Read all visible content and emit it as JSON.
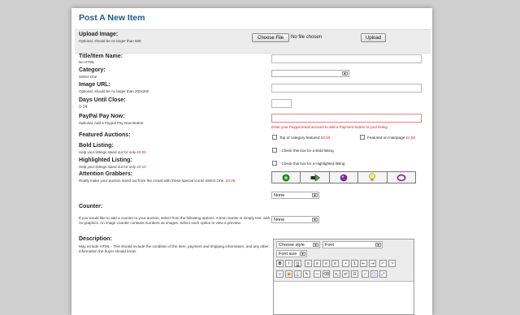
{
  "title": "Post A New Item",
  "upload": {
    "label": "Upload Image:",
    "hint": "Optional, should be no larger than 50K",
    "choose_file": "Choose File",
    "file_status": "No file chosen",
    "upload_button": "Upload"
  },
  "fields": {
    "title": {
      "label": "Title/Item Name:",
      "hint": "No HTML"
    },
    "category": {
      "label": "Category:",
      "hint": "Select One"
    },
    "image_url": {
      "label": "Image URL:",
      "hint": "Optional, should be no larger than 200x200"
    },
    "days": {
      "label": "Days Until Close:",
      "hint": "1-14"
    },
    "paypal": {
      "label": "PayPal Pay Now:",
      "hint": "Optional. Add a Paypal Pay Now Button.",
      "error": "Enter your Paypal email account to add a Payment button to your listing"
    }
  },
  "featured": {
    "label": "Featured Auctions:",
    "top_category": {
      "label": "Top of category featured",
      "price": "£0.50"
    },
    "mainpage": {
      "label": "Featured on mainpage",
      "price": "£1.50"
    }
  },
  "bold": {
    "label": "Bold Listing:",
    "hint": "Help your listings stand out for only",
    "price": "£0.05",
    "checkbox_label": ": Check this box for a Bold listing"
  },
  "highlighted": {
    "label": "Highlighted Listing:",
    "hint": "Help your listings stand out for only",
    "price": "£0.10",
    "checkbox_label": ": Check this box for a Highlighted listing"
  },
  "attention": {
    "label": "Attention Grabbers:",
    "hint": "Really make your auction stand out from the crowd with these special icons! Select One.",
    "price": "£0.05",
    "icons": [
      "green-gear-icon",
      "arrow-right-icon",
      "purple-orb-icon",
      "lightbulb-icon",
      "ring-icon"
    ],
    "select_value": "None"
  },
  "counter": {
    "label": "Counter:",
    "description": "If you would like to add a counter to your auction, select from the following options. A text counter is simply text, with no graphics. An image counter contains numbers as images. Select each option to view a preview.",
    "select_value": "None"
  },
  "description": {
    "label": "Description:",
    "hint": "May include HTML - This should include the condition of the item, payment and shipping information, and any other information the buyer should know.",
    "editor": {
      "style_select": "Choose style",
      "font_select": "Font",
      "size_select": "Font size",
      "bold_btn": "B",
      "italic_btn": "I",
      "underline_btn": "U"
    }
  },
  "colors": {
    "title": "#1f5b84",
    "price": "#cc2222",
    "background": "#cfcfcf"
  }
}
